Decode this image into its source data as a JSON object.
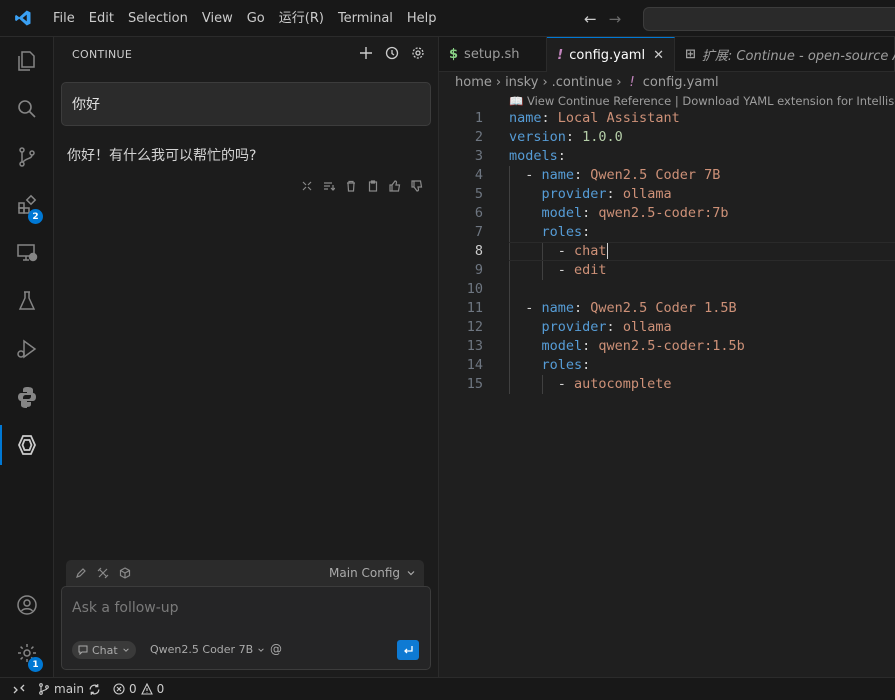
{
  "menu": [
    "File",
    "Edit",
    "Selection",
    "View",
    "Go",
    "运行(R)",
    "Terminal",
    "Help"
  ],
  "activity": {
    "extensions_badge": "2",
    "settings_badge": "1"
  },
  "sidebar": {
    "title": "CONTINUE",
    "user_message": "你好",
    "assistant_message": "你好！有什么我可以帮忙的吗?",
    "config_name": "Main Config",
    "input_placeholder": "Ask a follow-up",
    "mode": "Chat",
    "model": "Qwen2.5 Coder 7B",
    "at": "@"
  },
  "tabs": [
    {
      "icon": "$",
      "label": "setup.sh"
    },
    {
      "icon": "!",
      "label": "config.yaml"
    },
    {
      "icon": "⊞",
      "label": "扩展: Continue - open-source AI"
    }
  ],
  "breadcrumb": [
    "home",
    "insky",
    ".continue",
    "config.yaml"
  ],
  "codelens": "📖 View Continue Reference | Download YAML extension for Intellisense",
  "code": {
    "l1": {
      "num": "1",
      "key": "name",
      "val": "Local Assistant"
    },
    "l2": {
      "num": "2",
      "key": "version",
      "val": "1.0.0"
    },
    "l3": {
      "num": "3",
      "key": "models"
    },
    "l4": {
      "num": "4",
      "key": "name",
      "val": "Qwen2.5 Coder 7B"
    },
    "l5": {
      "num": "5",
      "key": "provider",
      "val": "ollama"
    },
    "l6": {
      "num": "6",
      "key": "model",
      "val": "qwen2.5-coder:7b"
    },
    "l7": {
      "num": "7",
      "key": "roles"
    },
    "l8": {
      "num": "8",
      "val": "chat"
    },
    "l9": {
      "num": "9",
      "val": "edit"
    },
    "l10": {
      "num": "10"
    },
    "l11": {
      "num": "11",
      "key": "name",
      "val": "Qwen2.5 Coder 1.5B"
    },
    "l12": {
      "num": "12",
      "key": "provider",
      "val": "ollama"
    },
    "l13": {
      "num": "13",
      "key": "model",
      "val": "qwen2.5-coder:1.5b"
    },
    "l14": {
      "num": "14",
      "key": "roles"
    },
    "l15": {
      "num": "15",
      "val": "autocomplete"
    }
  },
  "status": {
    "branch": "main",
    "errors": "0",
    "warnings": "0"
  },
  "colors": {
    "accent": "#0078d4",
    "yaml_key": "#569cd6",
    "yaml_value": "#ce9178"
  }
}
